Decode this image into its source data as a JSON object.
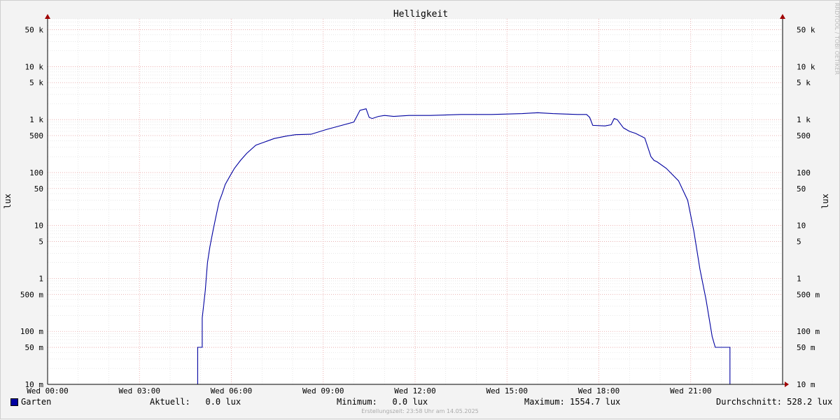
{
  "chart_data": {
    "type": "line",
    "title": "Helligkeit",
    "ylabel": "lux",
    "yscale": "log",
    "ylim": [
      10,
      80000
    ],
    "xlim": [
      0,
      24
    ],
    "grid": true,
    "x_ticks": [
      {
        "value": 0,
        "label": "Wed 00:00"
      },
      {
        "value": 3,
        "label": "Wed 03:00"
      },
      {
        "value": 6,
        "label": "Wed 06:00"
      },
      {
        "value": 9,
        "label": "Wed 09:00"
      },
      {
        "value": 12,
        "label": "Wed 12:00"
      },
      {
        "value": 15,
        "label": "Wed 15:00"
      },
      {
        "value": 18,
        "label": "Wed 18:00"
      },
      {
        "value": 21,
        "label": "Wed 21:00"
      }
    ],
    "y_ticks": [
      {
        "value": 0.01,
        "label": "10 m"
      },
      {
        "value": 0.05,
        "label": "50 m"
      },
      {
        "value": 0.1,
        "label": "100 m"
      },
      {
        "value": 0.5,
        "label": "500 m"
      },
      {
        "value": 1,
        "label": "1"
      },
      {
        "value": 5,
        "label": "5"
      },
      {
        "value": 10,
        "label": "10"
      },
      {
        "value": 50,
        "label": "50"
      },
      {
        "value": 100,
        "label": "100"
      },
      {
        "value": 500,
        "label": "500"
      },
      {
        "value": 1000,
        "label": "1 k"
      },
      {
        "value": 5000,
        "label": "5 k"
      },
      {
        "value": 10000,
        "label": "10 k"
      },
      {
        "value": 50000,
        "label": "50 k"
      }
    ],
    "series": [
      {
        "name": "Garten",
        "color": "#0000a0",
        "x": [
          0,
          4.9,
          4.9,
          5.05,
          5.05,
          5.15,
          5.22,
          5.3,
          5.4,
          5.5,
          5.6,
          5.7,
          5.8,
          5.95,
          6.1,
          6.3,
          6.5,
          6.8,
          7.1,
          7.4,
          7.8,
          8.1,
          8.6,
          9.1,
          9.5,
          10.0,
          10.2,
          10.4,
          10.5,
          10.6,
          10.8,
          11.0,
          11.3,
          11.8,
          12.5,
          13.5,
          14.5,
          15.5,
          16.0,
          16.5,
          17.3,
          17.6,
          17.7,
          17.8,
          18.2,
          18.4,
          18.5,
          18.6,
          18.8,
          19.0,
          19.2,
          19.5,
          19.7,
          19.8,
          19.9,
          20.2,
          20.6,
          20.9,
          21.1,
          21.3,
          21.5,
          21.7,
          21.8,
          21.9,
          22.0,
          22.1,
          22.15,
          22.2,
          22.28,
          22.28,
          24
        ],
        "y": [
          0.01,
          0.01,
          0.05,
          0.05,
          0.18,
          0.6,
          2,
          4,
          8,
          15,
          28,
          40,
          60,
          85,
          120,
          170,
          230,
          330,
          380,
          440,
          490,
          520,
          530,
          650,
          750,
          900,
          1500,
          1600,
          1100,
          1050,
          1150,
          1200,
          1150,
          1200,
          1200,
          1250,
          1250,
          1300,
          1350,
          1300,
          1250,
          1250,
          1100,
          780,
          760,
          800,
          1050,
          1000,
          700,
          600,
          550,
          450,
          200,
          170,
          160,
          120,
          70,
          30,
          8,
          1.5,
          0.4,
          0.08,
          0.05,
          0.05,
          0.05,
          0.05,
          0.05,
          0.05,
          0.05,
          0.01,
          0.01
        ]
      }
    ]
  },
  "legend": {
    "series_name": "Garten",
    "current": "Aktuell:   0.0 lux",
    "minimum": "Minimum:   0.0 lux",
    "maximum": "Maximum: 1554.7 lux",
    "average": "Durchschnitt: 528.2 lux"
  },
  "footer": "Erstellungszeit: 23:58 Uhr am 14.05.2025",
  "credit": "RRDTOOL / TOBI OETIKER",
  "colors": {
    "series": "#0000a0",
    "major_grid": "#e8a0a0",
    "minor_grid": "#d8d8d8",
    "plot_bg": "#ffffff",
    "page_bg": "#f3f3f3",
    "axis_arrow": "#a00000"
  }
}
